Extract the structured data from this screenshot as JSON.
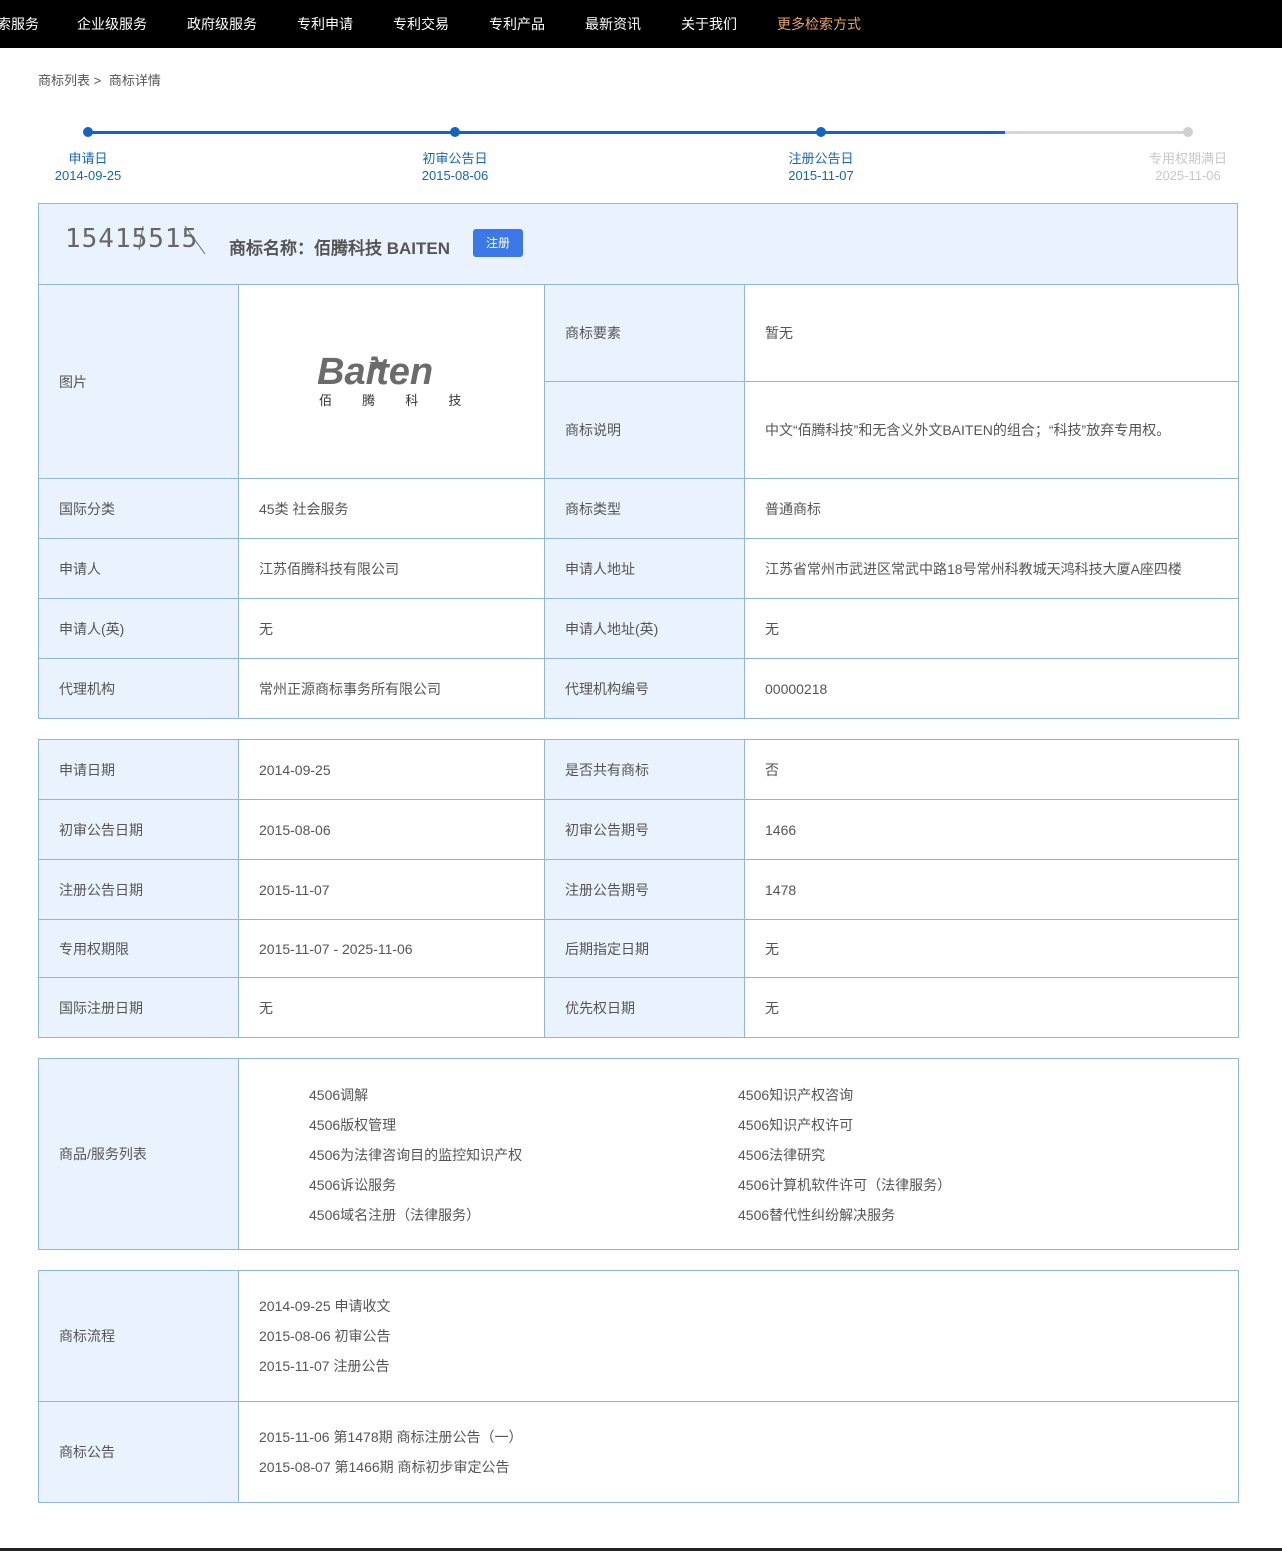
{
  "nav": [
    "索服务",
    "企业级服务",
    "政府级服务",
    "专利申请",
    "专利交易",
    "专利产品",
    "最新资讯",
    "关于我们",
    "更多检索方式"
  ],
  "breadcrumb": {
    "list": "商标列表 >",
    "current": "商标详情"
  },
  "timeline": [
    {
      "label": "申请日",
      "date": "2014-09-25",
      "done": true
    },
    {
      "label": "初审公告日",
      "date": "2015-08-06",
      "done": true
    },
    {
      "label": "注册公告日",
      "date": "2015-11-07",
      "done": true
    },
    {
      "label": "专用权期满日",
      "date": "2025-11-06",
      "done": false
    }
  ],
  "header": {
    "reg_no": "15415515",
    "title": "商标名称：佰腾科技 BAITEN",
    "status": "注册"
  },
  "logo": {
    "brand": "Baiten",
    "chinese": "佰 腾 科 技"
  },
  "basic": {
    "image_label": "图片",
    "elements_label": "商标要素",
    "elements_value": "暂无",
    "desc_label": "商标说明",
    "desc_value": "中文“佰腾科技”和无含义外文BAITEN的组合；“科技”放弃专用权。",
    "rows": [
      {
        "k1": "国际分类",
        "v1": "45类 社会服务",
        "k2": "商标类型",
        "v2": "普通商标"
      },
      {
        "k1": "申请人",
        "v1": "江苏佰腾科技有限公司",
        "k2": "申请人地址",
        "v2": "江苏省常州市武进区常武中路18号常州科教城天鸿科技大厦A座四楼"
      },
      {
        "k1": "申请人(英)",
        "v1": "无",
        "k2": "申请人地址(英)",
        "v2": "无"
      },
      {
        "k1": "代理机构",
        "v1": "常州正源商标事务所有限公司",
        "k2": "代理机构编号",
        "v2": "00000218"
      }
    ]
  },
  "dates": [
    {
      "k1": "申请日期",
      "v1": "2014-09-25",
      "k2": "是否共有商标",
      "v2": "否"
    },
    {
      "k1": "初审公告日期",
      "v1": "2015-08-06",
      "k2": "初审公告期号",
      "v2": "1466"
    },
    {
      "k1": "注册公告日期",
      "v1": "2015-11-07",
      "k2": "注册公告期号",
      "v2": "1478"
    },
    {
      "k1": "专用权期限",
      "v1": "2015-11-07 - 2025-11-06",
      "k2": "后期指定日期",
      "v2": "无"
    },
    {
      "k1": "国际注册日期",
      "v1": "无",
      "k2": "优先权日期",
      "v2": "无"
    }
  ],
  "goods": {
    "label": "商品/服务列表",
    "left": [
      "4506调解",
      "4506版权管理",
      "4506为法律咨询目的监控知识产权",
      "4506诉讼服务",
      "4506域名注册（法律服务）"
    ],
    "right": [
      "4506知识产权咨询",
      "4506知识产权许可",
      "4506法律研究",
      "4506计算机软件许可（法律服务）",
      "4506替代性纠纷解决服务"
    ]
  },
  "process": {
    "label": "商标流程",
    "items": [
      "2014-09-25 申请收文",
      "2015-08-06 初审公告",
      "2015-11-07 注册公告"
    ]
  },
  "notice": {
    "label": "商标公告",
    "items": [
      "2015-11-06 第1478期 商标注册公告（一）",
      "2015-08-07 第1466期 商标初步审定公告"
    ]
  },
  "colors": {
    "accent": "#1565c0",
    "panel": "#eaf3fd",
    "border": "#8fb6dc",
    "nav_highlight": "#e0a561",
    "status_button": "#3c78e8"
  }
}
